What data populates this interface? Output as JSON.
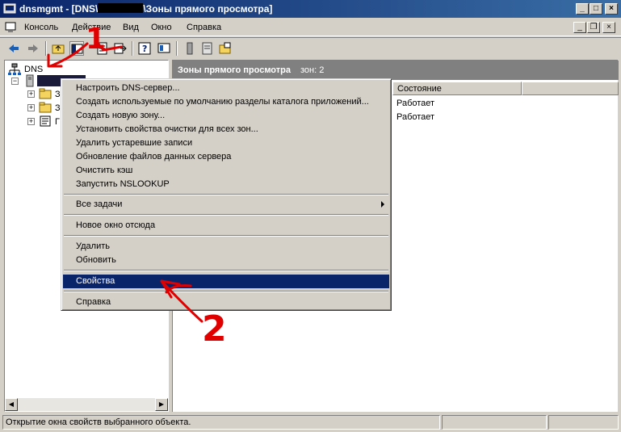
{
  "window": {
    "title_prefix": "dnsmgmt - [DNS\\",
    "title_suffix": "\\Зоны прямого просмотра]",
    "minimize_icon": "minimize-icon",
    "maximize_icon": "maximize-icon",
    "close_icon": "close-icon"
  },
  "menubar": {
    "items": [
      "Консоль",
      "Действие",
      "Вид",
      "Окно",
      "Справка"
    ]
  },
  "toolbar": {
    "icons": [
      "back-icon",
      "forward-icon",
      "up-folder-icon",
      "show-tree-icon",
      "properties-icon",
      "export-icon",
      "help-icon",
      "view-icon",
      "server-icon",
      "zone-icon",
      "new-folder-icon"
    ]
  },
  "tree": {
    "root_label": "DNS",
    "children": [
      "З",
      "З",
      "Г"
    ]
  },
  "right_pane": {
    "title": "Зоны прямого просмотра",
    "count": "зон: 2",
    "columns": [
      "Состояние"
    ],
    "rows": [
      {
        "status": "Работает"
      },
      {
        "status": "Работает"
      }
    ]
  },
  "context_menu": {
    "group1": [
      "Настроить DNS-сервер...",
      "Создать используемые по умолчанию разделы каталога приложений...",
      "Создать новую зону...",
      "Установить свойства очистки для всех зон...",
      "Удалить устаревшие записи",
      "Обновление файлов данных сервера",
      "Очистить кэш",
      "Запустить NSLOOKUP"
    ],
    "all_tasks": "Все задачи",
    "new_window": "Новое окно отсюда",
    "delete": "Удалить",
    "refresh": "Обновить",
    "properties": "Свойства",
    "help": "Справка"
  },
  "annotations": {
    "one": "1",
    "two": "2",
    "color": "#e00000"
  },
  "statusbar": {
    "text": "Открытие окна свойств выбранного объекта."
  }
}
